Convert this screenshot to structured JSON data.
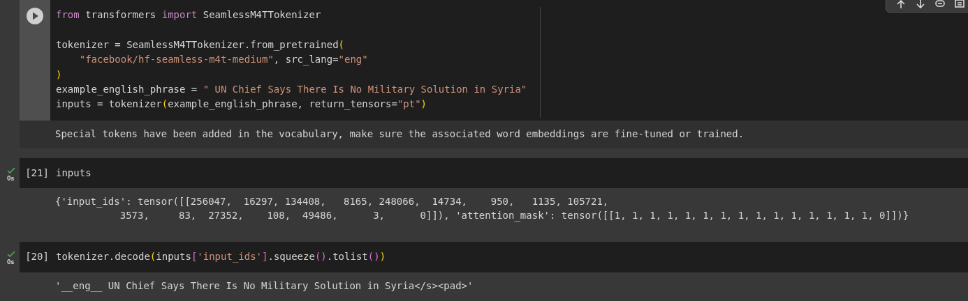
{
  "cell_toolbar": {
    "buttons": [
      {
        "kind": "arrow-up"
      },
      {
        "kind": "arrow-down"
      },
      {
        "kind": "link"
      },
      {
        "kind": "comment"
      }
    ]
  },
  "cells": [
    {
      "focused": true,
      "lines": [
        {
          "tokens": [
            {
              "kind": "keyword",
              "text": "from"
            },
            {
              "kind": "plain",
              "text": " transformers "
            },
            {
              "kind": "keyword",
              "text": "import"
            },
            {
              "kind": "plain",
              "text": " SeamlessM4TTokenizer"
            }
          ]
        },
        {
          "kind": "blank"
        },
        {
          "tokens": [
            {
              "kind": "plain",
              "text": "tokenizer = SeamlessM4TTokenizer.from_pretrained"
            },
            {
              "kind": "paren",
              "text": "("
            }
          ]
        },
        {
          "kind": "continuation",
          "tokens": [
            {
              "kind": "string",
              "text": "\"facebook/hf-seamless-m4t-medium\""
            },
            {
              "kind": "plain",
              "text": ", src_lang="
            },
            {
              "kind": "string",
              "text": "\"eng\""
            }
          ]
        },
        {
          "tokens": [
            {
              "kind": "paren",
              "text": ")"
            }
          ]
        },
        {
          "tokens": [
            {
              "kind": "plain",
              "text": "example_english_phrase = "
            },
            {
              "kind": "string",
              "text": "\" UN Chief Says There Is No Military Solution in Syria\""
            }
          ]
        },
        {
          "tokens": [
            {
              "kind": "plain",
              "text": "inputs = tokenizer"
            },
            {
              "kind": "paren",
              "text": "("
            },
            {
              "kind": "plain",
              "text": "example_english_phrase, return_tensors="
            },
            {
              "kind": "string",
              "text": "\"pt\""
            },
            {
              "kind": "paren",
              "text": ")"
            }
          ]
        }
      ],
      "output": {
        "kind": "stderr",
        "lines": [
          "Special tokens have been added in the vocabulary, make sure the associated word embeddings are fine-tuned or trained."
        ]
      }
    },
    {
      "focused": false,
      "execution_count": "[21]",
      "run_time": "0s",
      "lines": [
        {
          "tokens": [
            {
              "kind": "plain",
              "text": "inputs"
            }
          ]
        }
      ],
      "output": {
        "kind": "result",
        "lines": [
          "{'input_ids': tensor([[256047,  16297, 134408,   8165, 248066,  14734,    950,   1135, 105721,",
          "           3573,     83,  27352,    108,  49486,      3,      0]]), 'attention_mask': tensor([[1, 1, 1, 1, 1, 1, 1, 1, 1, 1, 1, 1, 1, 1, 1, 0]])}"
        ]
      }
    },
    {
      "focused": false,
      "execution_count": "[20]",
      "run_time": "0s",
      "lines": [
        {
          "tokens": [
            {
              "kind": "plain",
              "text": "tokenizer.decode"
            },
            {
              "kind": "paren",
              "text": "("
            },
            {
              "kind": "plain",
              "text": "inputs"
            },
            {
              "kind": "bracket",
              "text": "["
            },
            {
              "kind": "string",
              "text": "'input_ids'"
            },
            {
              "kind": "bracket",
              "text": "]"
            },
            {
              "kind": "plain",
              "text": ".squeeze"
            },
            {
              "kind": "bracket",
              "text": "()"
            },
            {
              "kind": "plain",
              "text": ".tolist"
            },
            {
              "kind": "bracket",
              "text": "()"
            },
            {
              "kind": "paren",
              "text": ")"
            }
          ]
        }
      ],
      "output": {
        "kind": "result",
        "lines": [
          "'__eng__ UN Chief Says There Is No Military Solution in Syria</s><pad>'"
        ]
      }
    }
  ]
}
